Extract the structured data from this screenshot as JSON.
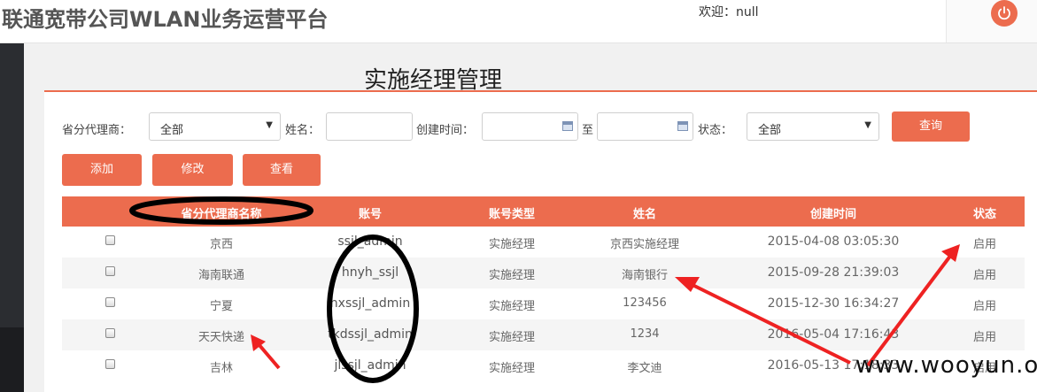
{
  "header": {
    "app_title": "联通宽带公司WLAN业务运营平台",
    "welcome": "欢迎：null",
    "logout_icon": "power-icon",
    "accent_color": "#ec6c4e"
  },
  "page": {
    "title": "实施经理管理"
  },
  "filters": {
    "agent_label": "省分代理商：",
    "agent_value": "全部",
    "name_label": "姓名：",
    "name_value": "",
    "created_label": "创建时间：",
    "date_from_value": "",
    "to_label": "至",
    "date_to_value": "",
    "status_label": "状态：",
    "status_value": "全部",
    "query_button": "查询",
    "calendar_icon": "calendar-icon"
  },
  "actions": {
    "add": "添加",
    "edit": "修改",
    "view": "查看"
  },
  "table": {
    "headers": [
      "省分代理商名称",
      "账号",
      "账号类型",
      "姓名",
      "创建时间",
      "状态"
    ],
    "rows": [
      {
        "agent": "京西",
        "account": "ssjl_admin",
        "type": "实施经理",
        "name": "京西实施经理",
        "created": "2015-04-08 03:05:30",
        "status": "启用"
      },
      {
        "agent": "海南联通",
        "account": "hnyh_ssjl",
        "type": "实施经理",
        "name": "海南银行",
        "created": "2015-09-28 21:39:03",
        "status": "启用"
      },
      {
        "agent": "宁夏",
        "account": "nxssjl_admin",
        "type": "实施经理",
        "name": "123456",
        "created": "2015-12-30 16:34:27",
        "status": "启用"
      },
      {
        "agent": "天天快递",
        "account": "tkdssjl_admin",
        "type": "实施经理",
        "name": "1234",
        "created": "2016-05-04 17:16:43",
        "status": "启用"
      },
      {
        "agent": "吉林",
        "account": "jlssjl_admin",
        "type": "实施经理",
        "name": "李文迪",
        "created": "2016-05-13 17:18:33",
        "status": "启用"
      }
    ]
  },
  "watermark": "www.wooyun.org"
}
